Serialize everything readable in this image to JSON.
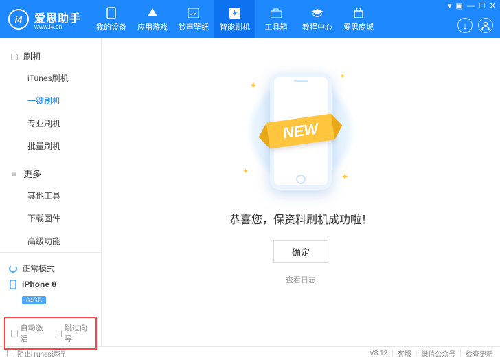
{
  "header": {
    "logo_text": "爱思助手",
    "logo_sub": "www.i4.cn",
    "logo_mark": "i4",
    "tabs": [
      {
        "label": "我的设备"
      },
      {
        "label": "应用游戏"
      },
      {
        "label": "铃声壁纸"
      },
      {
        "label": "智能刷机"
      },
      {
        "label": "工具箱"
      },
      {
        "label": "教程中心"
      },
      {
        "label": "爱思商城"
      }
    ]
  },
  "sidebar": {
    "sec1_title": "刷机",
    "sec1_items": [
      "iTunes刷机",
      "一键刷机",
      "专业刷机",
      "批量刷机"
    ],
    "sec2_title": "更多",
    "sec2_items": [
      "其他工具",
      "下载固件",
      "高级功能"
    ],
    "mode": "正常模式",
    "device": "iPhone 8",
    "storage": "64GB",
    "auto_activate": "自动激活",
    "skip_guide": "跳过向导"
  },
  "main": {
    "ribbon": "NEW",
    "message": "恭喜您，保资料刷机成功啦！",
    "ok": "确定",
    "view_log": "查看日志"
  },
  "footer": {
    "block_itunes": "阻止iTunes运行",
    "version": "V8.12",
    "svc": "客服",
    "wechat": "微信公众号",
    "update": "检查更新"
  }
}
